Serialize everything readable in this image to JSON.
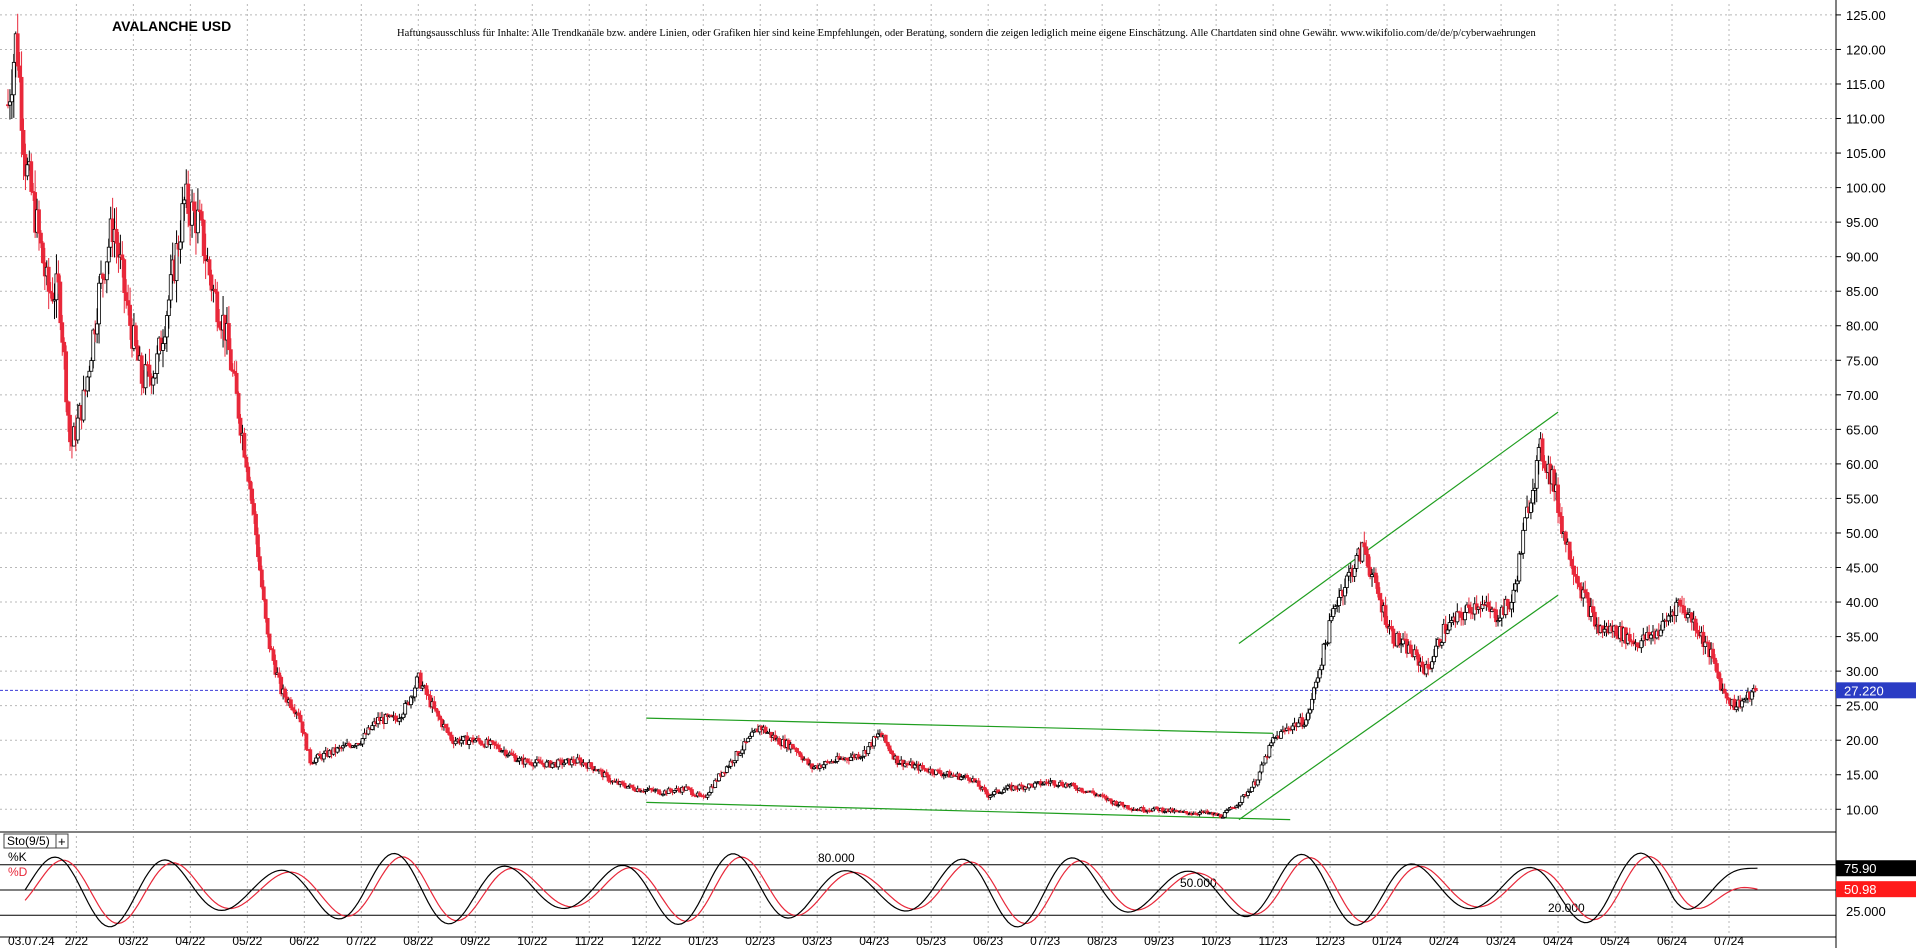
{
  "chart_data": {
    "type": "candlestick",
    "title": "AVALANCHE USD",
    "disclaimer": "Haftungsausschluss für Inhalte: Alle Trendkanäle bzw. andere Linien, oder Grafiken hier sind keine Empfehlungen, oder Beratung, sondern die zeigen lediglich meine eigene Einschätzung. Alle Chartdaten sind ohne Gewähr.  www.wikifolio.com/de/de/p/cyberwaehrungen",
    "ylim": [
      7,
      126
    ],
    "y_ticks": [
      "125.00",
      "120.00",
      "115.00",
      "110.00",
      "105.00",
      "100.00",
      "95.00",
      "90.00",
      "85.00",
      "80.00",
      "75.00",
      "70.00",
      "65.00",
      "60.00",
      "55.00",
      "50.00",
      "45.00",
      "40.00",
      "35.00",
      "30.00",
      "25.00",
      "20.00",
      "15.00",
      "10.00"
    ],
    "x_ticks": [
      "03.07.24",
      "2/22",
      "03/22",
      "04/22",
      "05/22",
      "06/22",
      "07/22",
      "08/22",
      "09/22",
      "10/22",
      "11/22",
      "12/22",
      "01/23",
      "02/23",
      "03/23",
      "04/23",
      "05/23",
      "06/23",
      "07/23",
      "08/23",
      "09/23",
      "10/23",
      "11/23",
      "12/23",
      "01/24",
      "02/24",
      "03/24",
      "04/24",
      "05/24",
      "06/24",
      "07/24"
    ],
    "x_ticks_pos": [
      0,
      1.2,
      2.2,
      3.2,
      4.2,
      5.2,
      6.2,
      7.2,
      8.2,
      9.2,
      10.2,
      11.2,
      12.2,
      13.2,
      14.2,
      15.2,
      16.2,
      17.2,
      18.2,
      19.2,
      20.2,
      21.2,
      22.2,
      23.2,
      24.2,
      25.2,
      26.2,
      27.2,
      28.2,
      29.2,
      30.2
    ],
    "x_range": [
      0,
      31.2
    ],
    "price_path": [
      [
        0,
        112
      ],
      [
        0.15,
        122
      ],
      [
        0.3,
        104
      ],
      [
        0.5,
        95
      ],
      [
        0.7,
        85
      ],
      [
        0.9,
        85
      ],
      [
        1.1,
        62
      ],
      [
        1.35,
        70
      ],
      [
        1.6,
        85
      ],
      [
        1.85,
        95
      ],
      [
        2.1,
        82
      ],
      [
        2.35,
        72
      ],
      [
        2.6,
        74
      ],
      [
        2.85,
        85
      ],
      [
        3.1,
        98
      ],
      [
        3.35,
        95
      ],
      [
        3.6,
        85
      ],
      [
        3.8,
        80
      ],
      [
        4.0,
        70
      ],
      [
        4.2,
        60
      ],
      [
        4.35,
        50
      ],
      [
        4.55,
        35
      ],
      [
        4.8,
        27
      ],
      [
        5.1,
        24
      ],
      [
        5.3,
        17
      ],
      [
        5.6,
        18
      ],
      [
        5.9,
        19
      ],
      [
        6.2,
        20
      ],
      [
        6.5,
        23
      ],
      [
        6.8,
        23
      ],
      [
        7.0,
        25
      ],
      [
        7.2,
        29
      ],
      [
        7.5,
        24
      ],
      [
        7.8,
        20
      ],
      [
        8.2,
        20
      ],
      [
        8.6,
        19
      ],
      [
        9.0,
        17
      ],
      [
        9.5,
        16.5
      ],
      [
        10.0,
        17
      ],
      [
        10.3,
        16
      ],
      [
        10.6,
        14
      ],
      [
        11.0,
        13
      ],
      [
        11.5,
        12.5
      ],
      [
        11.9,
        13
      ],
      [
        12.2,
        11.5
      ],
      [
        12.5,
        15
      ],
      [
        13.0,
        20
      ],
      [
        13.2,
        22
      ],
      [
        13.5,
        20
      ],
      [
        13.8,
        19
      ],
      [
        14.1,
        16
      ],
      [
        14.5,
        17
      ],
      [
        15.0,
        18
      ],
      [
        15.3,
        21
      ],
      [
        15.6,
        17
      ],
      [
        16.0,
        16
      ],
      [
        16.5,
        15
      ],
      [
        16.9,
        14.5
      ],
      [
        17.2,
        12
      ],
      [
        17.5,
        13
      ],
      [
        18.0,
        13.5
      ],
      [
        18.3,
        14
      ],
      [
        18.6,
        13.5
      ],
      [
        19.0,
        12.5
      ],
      [
        19.4,
        11
      ],
      [
        19.8,
        10
      ],
      [
        20.2,
        10
      ],
      [
        20.6,
        9.5
      ],
      [
        21.0,
        9.5
      ],
      [
        21.3,
        9
      ],
      [
        21.6,
        11
      ],
      [
        21.9,
        14
      ],
      [
        22.2,
        20
      ],
      [
        22.5,
        22
      ],
      [
        22.8,
        23
      ],
      [
        23.0,
        30
      ],
      [
        23.3,
        40
      ],
      [
        23.6,
        45
      ],
      [
        23.8,
        48
      ],
      [
        24.0,
        42
      ],
      [
        24.3,
        35
      ],
      [
        24.6,
        33
      ],
      [
        24.9,
        30
      ],
      [
        25.2,
        36
      ],
      [
        25.5,
        38
      ],
      [
        25.8,
        40
      ],
      [
        26.1,
        38
      ],
      [
        26.4,
        40
      ],
      [
        26.7,
        55
      ],
      [
        26.9,
        62
      ],
      [
        27.1,
        58
      ],
      [
        27.3,
        50
      ],
      [
        27.6,
        42
      ],
      [
        27.9,
        36
      ],
      [
        28.2,
        36
      ],
      [
        28.6,
        34
      ],
      [
        29.0,
        36
      ],
      [
        29.3,
        40
      ],
      [
        29.6,
        37
      ],
      [
        29.9,
        32
      ],
      [
        30.1,
        27
      ],
      [
        30.3,
        25
      ],
      [
        30.5,
        26
      ],
      [
        30.7,
        27.2
      ]
    ],
    "current_price": "27.220",
    "current_price_value": 27.22,
    "trendlines": [
      {
        "from": [
          11.2,
          23.2
        ],
        "to": [
          22.2,
          21
        ]
      },
      {
        "from": [
          11.2,
          11
        ],
        "to": [
          22.5,
          8.5
        ]
      },
      {
        "from": [
          21.6,
          34
        ],
        "to": [
          27.2,
          67.5
        ]
      },
      {
        "from": [
          21.6,
          8.5
        ],
        "to": [
          27.2,
          41
        ]
      }
    ],
    "indicator": {
      "name": "Sto(9/5)",
      "k_label": "%K",
      "d_label": "%D",
      "levels": [
        80,
        50,
        20
      ],
      "level_labels": [
        "80.000",
        "50.000",
        "20.000"
      ],
      "y_tick": "25.000",
      "k_value": "75.90",
      "d_value": "50.98",
      "k_num": 75.9,
      "d_num": 50.98
    },
    "colors": {
      "up": "#000000",
      "down": "#e8283a",
      "trend": "#1f9e1f",
      "price_line": "#3c3cd8",
      "grid": "#b8b8b8",
      "k_line": "#000000",
      "d_line": "#e8283a"
    }
  }
}
